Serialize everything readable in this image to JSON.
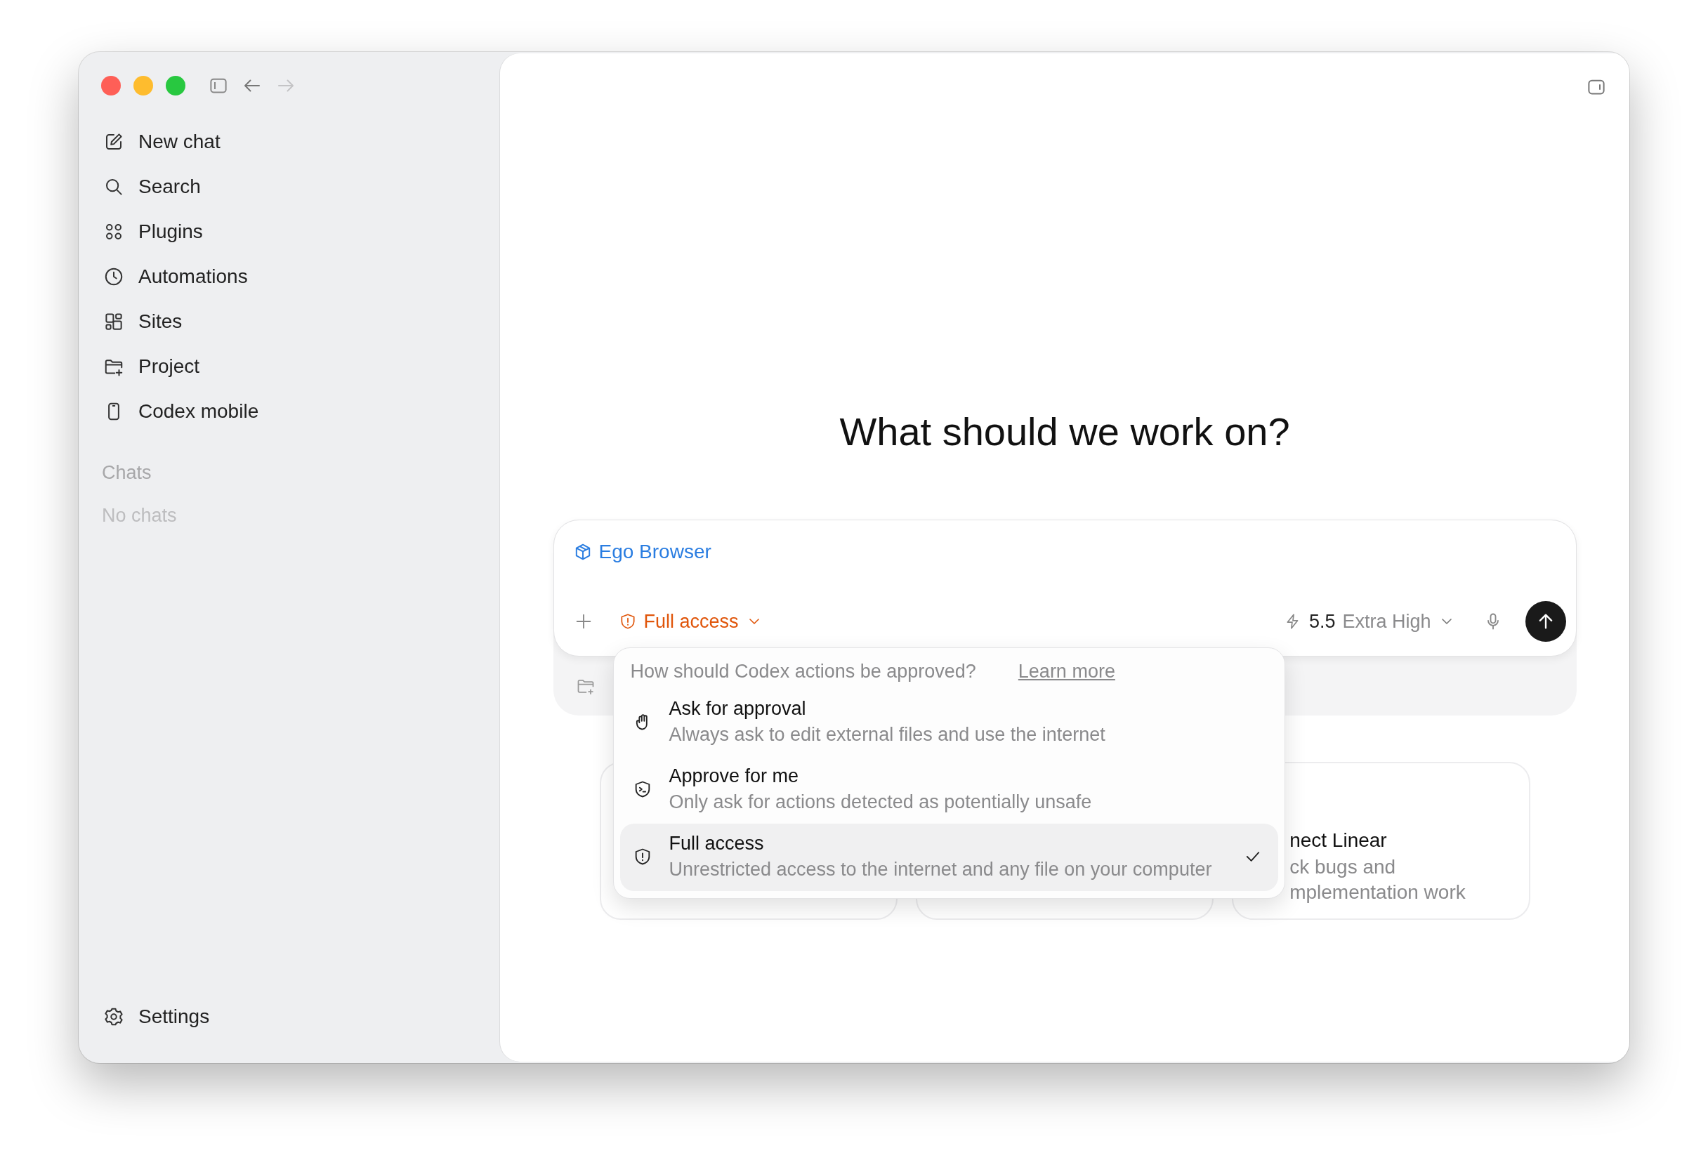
{
  "nav": [
    {
      "kind": "back",
      "disabled": false
    },
    {
      "kind": "forward",
      "disabled": true
    }
  ],
  "sidebar": {
    "items": [
      {
        "kind": "compose",
        "label": "New chat"
      },
      {
        "kind": "search",
        "label": "Search"
      },
      {
        "kind": "plugins",
        "label": "Plugins"
      },
      {
        "kind": "clock",
        "label": "Automations"
      },
      {
        "kind": "sites",
        "label": "Sites"
      },
      {
        "kind": "folder",
        "label": "Project"
      },
      {
        "kind": "phone",
        "label": "Codex mobile"
      }
    ],
    "section_title": "Chats",
    "empty_text": "No chats",
    "settings": "Settings"
  },
  "main": {
    "heading": "What should we work on?",
    "composer": {
      "context": "Ego Browser",
      "access": "Full access",
      "model": "5.5",
      "effort": "Extra High"
    },
    "approval_menu": {
      "question": "How should Codex actions be approved?",
      "link": "Learn more",
      "options": [
        {
          "kind": "hand",
          "title": "Ask for approval",
          "description": "Always ask to edit external files and use the internet",
          "selected": false
        },
        {
          "kind": "terminal",
          "title": "Approve for me",
          "description": "Only ask for actions detected as potentially unsafe",
          "selected": false
        },
        {
          "kind": "alert",
          "title": "Full access",
          "description": "Unrestricted access to the internet and any file on your computer",
          "selected": true
        }
      ]
    },
    "suggestion_cards": [
      {
        "kind": "covered"
      },
      {
        "kind": "covered"
      },
      {
        "kind": "text",
        "title": "nect Linear",
        "description": [
          "ck bugs and",
          "mplementation work"
        ]
      }
    ]
  }
}
